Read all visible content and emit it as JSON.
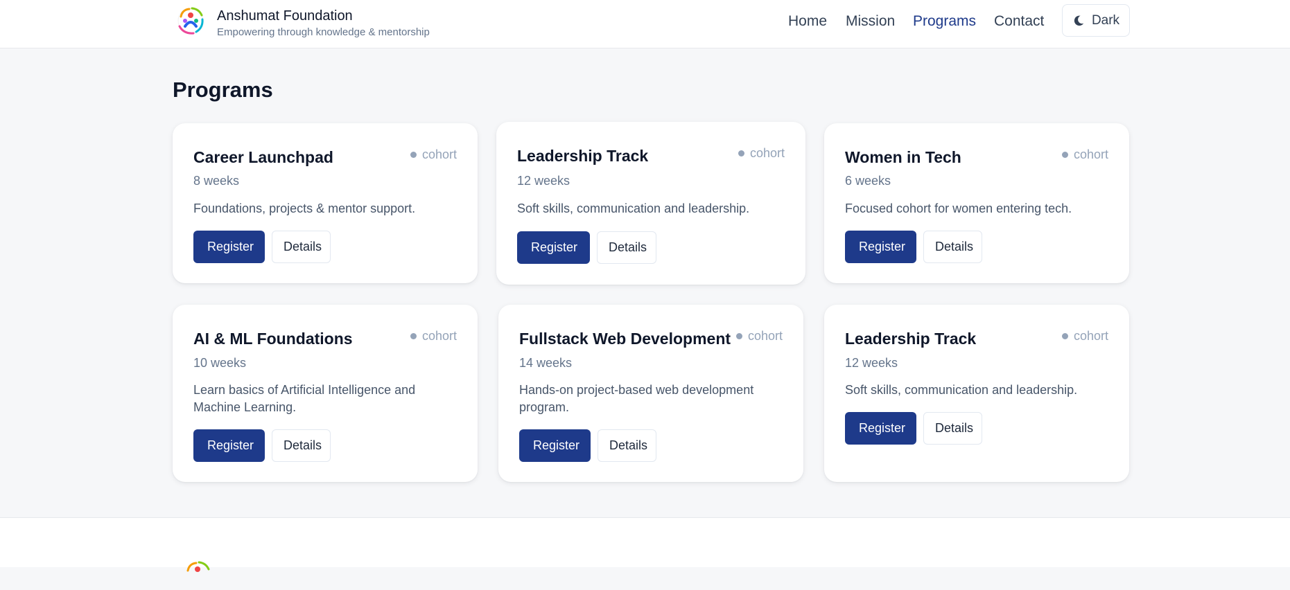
{
  "brand": {
    "name": "Anshumat Foundation",
    "tagline": "Empowering through knowledge & mentorship",
    "logo_icon": "people-circle-logo-icon"
  },
  "nav": {
    "items": [
      {
        "label": "Home"
      },
      {
        "label": "Mission"
      },
      {
        "label": "Programs",
        "active": true
      },
      {
        "label": "Contact"
      }
    ],
    "theme_toggle_label": "Dark",
    "theme_toggle_icon": "moon-icon"
  },
  "programs": {
    "title": "Programs",
    "cards": [
      {
        "title": "Career Launchpad",
        "badge": "cohort",
        "duration": "8 weeks",
        "description": "Foundations, projects & mentor support.",
        "register_label": "Register",
        "details_label": "Details"
      },
      {
        "title": "Leadership Track",
        "badge": "cohort",
        "duration": "12 weeks",
        "description": "Soft skills, communication and leadership.",
        "register_label": "Register",
        "details_label": "Details"
      },
      {
        "title": "Women in Tech",
        "badge": "cohort",
        "duration": "6 weeks",
        "description": "Focused cohort for women entering tech.",
        "register_label": "Register",
        "details_label": "Details"
      },
      {
        "title": "AI & ML Foundations",
        "badge": "cohort",
        "duration": "10 weeks",
        "description": "Learn basics of Artificial Intelligence and Machine Learning.",
        "register_label": "Register",
        "details_label": "Details"
      },
      {
        "title": "Fullstack Web Development",
        "badge": "cohort",
        "duration": "14 weeks",
        "description": "Hands-on project-based web development program.",
        "register_label": "Register",
        "details_label": "Details"
      },
      {
        "title": "Leadership Track",
        "badge": "cohort",
        "duration": "12 weeks",
        "description": "Soft skills, communication and leadership.",
        "register_label": "Register",
        "details_label": "Details"
      }
    ]
  },
  "colors": {
    "primary": "#1e3a8a",
    "background": "#f6f7f9",
    "card": "#ffffff",
    "muted_text": "#64748b"
  }
}
